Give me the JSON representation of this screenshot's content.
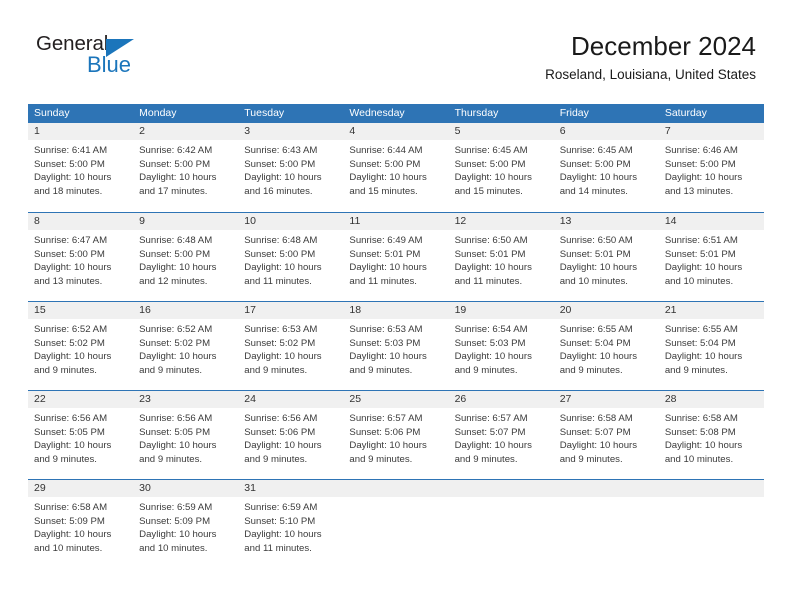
{
  "logo": {
    "word_general": "General",
    "word_blue": "Blue",
    "triangle_color": "#1b75bb"
  },
  "header": {
    "title": "December 2024",
    "subtitle": "Roseland, Louisiana, United States"
  },
  "colors": {
    "header_blue": "#2e74b5",
    "day_band_gray": "#f0f0f0",
    "text": "#3b3b3b"
  },
  "weekdays": [
    "Sunday",
    "Monday",
    "Tuesday",
    "Wednesday",
    "Thursday",
    "Friday",
    "Saturday"
  ],
  "weeks": [
    [
      {
        "day": "1",
        "sunrise": "Sunrise: 6:41 AM",
        "sunset": "Sunset: 5:00 PM",
        "daylight1": "Daylight: 10 hours",
        "daylight2": "and 18 minutes."
      },
      {
        "day": "2",
        "sunrise": "Sunrise: 6:42 AM",
        "sunset": "Sunset: 5:00 PM",
        "daylight1": "Daylight: 10 hours",
        "daylight2": "and 17 minutes."
      },
      {
        "day": "3",
        "sunrise": "Sunrise: 6:43 AM",
        "sunset": "Sunset: 5:00 PM",
        "daylight1": "Daylight: 10 hours",
        "daylight2": "and 16 minutes."
      },
      {
        "day": "4",
        "sunrise": "Sunrise: 6:44 AM",
        "sunset": "Sunset: 5:00 PM",
        "daylight1": "Daylight: 10 hours",
        "daylight2": "and 15 minutes."
      },
      {
        "day": "5",
        "sunrise": "Sunrise: 6:45 AM",
        "sunset": "Sunset: 5:00 PM",
        "daylight1": "Daylight: 10 hours",
        "daylight2": "and 15 minutes."
      },
      {
        "day": "6",
        "sunrise": "Sunrise: 6:45 AM",
        "sunset": "Sunset: 5:00 PM",
        "daylight1": "Daylight: 10 hours",
        "daylight2": "and 14 minutes."
      },
      {
        "day": "7",
        "sunrise": "Sunrise: 6:46 AM",
        "sunset": "Sunset: 5:00 PM",
        "daylight1": "Daylight: 10 hours",
        "daylight2": "and 13 minutes."
      }
    ],
    [
      {
        "day": "8",
        "sunrise": "Sunrise: 6:47 AM",
        "sunset": "Sunset: 5:00 PM",
        "daylight1": "Daylight: 10 hours",
        "daylight2": "and 13 minutes."
      },
      {
        "day": "9",
        "sunrise": "Sunrise: 6:48 AM",
        "sunset": "Sunset: 5:00 PM",
        "daylight1": "Daylight: 10 hours",
        "daylight2": "and 12 minutes."
      },
      {
        "day": "10",
        "sunrise": "Sunrise: 6:48 AM",
        "sunset": "Sunset: 5:00 PM",
        "daylight1": "Daylight: 10 hours",
        "daylight2": "and 11 minutes."
      },
      {
        "day": "11",
        "sunrise": "Sunrise: 6:49 AM",
        "sunset": "Sunset: 5:01 PM",
        "daylight1": "Daylight: 10 hours",
        "daylight2": "and 11 minutes."
      },
      {
        "day": "12",
        "sunrise": "Sunrise: 6:50 AM",
        "sunset": "Sunset: 5:01 PM",
        "daylight1": "Daylight: 10 hours",
        "daylight2": "and 11 minutes."
      },
      {
        "day": "13",
        "sunrise": "Sunrise: 6:50 AM",
        "sunset": "Sunset: 5:01 PM",
        "daylight1": "Daylight: 10 hours",
        "daylight2": "and 10 minutes."
      },
      {
        "day": "14",
        "sunrise": "Sunrise: 6:51 AM",
        "sunset": "Sunset: 5:01 PM",
        "daylight1": "Daylight: 10 hours",
        "daylight2": "and 10 minutes."
      }
    ],
    [
      {
        "day": "15",
        "sunrise": "Sunrise: 6:52 AM",
        "sunset": "Sunset: 5:02 PM",
        "daylight1": "Daylight: 10 hours",
        "daylight2": "and 9 minutes."
      },
      {
        "day": "16",
        "sunrise": "Sunrise: 6:52 AM",
        "sunset": "Sunset: 5:02 PM",
        "daylight1": "Daylight: 10 hours",
        "daylight2": "and 9 minutes."
      },
      {
        "day": "17",
        "sunrise": "Sunrise: 6:53 AM",
        "sunset": "Sunset: 5:02 PM",
        "daylight1": "Daylight: 10 hours",
        "daylight2": "and 9 minutes."
      },
      {
        "day": "18",
        "sunrise": "Sunrise: 6:53 AM",
        "sunset": "Sunset: 5:03 PM",
        "daylight1": "Daylight: 10 hours",
        "daylight2": "and 9 minutes."
      },
      {
        "day": "19",
        "sunrise": "Sunrise: 6:54 AM",
        "sunset": "Sunset: 5:03 PM",
        "daylight1": "Daylight: 10 hours",
        "daylight2": "and 9 minutes."
      },
      {
        "day": "20",
        "sunrise": "Sunrise: 6:55 AM",
        "sunset": "Sunset: 5:04 PM",
        "daylight1": "Daylight: 10 hours",
        "daylight2": "and 9 minutes."
      },
      {
        "day": "21",
        "sunrise": "Sunrise: 6:55 AM",
        "sunset": "Sunset: 5:04 PM",
        "daylight1": "Daylight: 10 hours",
        "daylight2": "and 9 minutes."
      }
    ],
    [
      {
        "day": "22",
        "sunrise": "Sunrise: 6:56 AM",
        "sunset": "Sunset: 5:05 PM",
        "daylight1": "Daylight: 10 hours",
        "daylight2": "and 9 minutes."
      },
      {
        "day": "23",
        "sunrise": "Sunrise: 6:56 AM",
        "sunset": "Sunset: 5:05 PM",
        "daylight1": "Daylight: 10 hours",
        "daylight2": "and 9 minutes."
      },
      {
        "day": "24",
        "sunrise": "Sunrise: 6:56 AM",
        "sunset": "Sunset: 5:06 PM",
        "daylight1": "Daylight: 10 hours",
        "daylight2": "and 9 minutes."
      },
      {
        "day": "25",
        "sunrise": "Sunrise: 6:57 AM",
        "sunset": "Sunset: 5:06 PM",
        "daylight1": "Daylight: 10 hours",
        "daylight2": "and 9 minutes."
      },
      {
        "day": "26",
        "sunrise": "Sunrise: 6:57 AM",
        "sunset": "Sunset: 5:07 PM",
        "daylight1": "Daylight: 10 hours",
        "daylight2": "and 9 minutes."
      },
      {
        "day": "27",
        "sunrise": "Sunrise: 6:58 AM",
        "sunset": "Sunset: 5:07 PM",
        "daylight1": "Daylight: 10 hours",
        "daylight2": "and 9 minutes."
      },
      {
        "day": "28",
        "sunrise": "Sunrise: 6:58 AM",
        "sunset": "Sunset: 5:08 PM",
        "daylight1": "Daylight: 10 hours",
        "daylight2": "and 10 minutes."
      }
    ],
    [
      {
        "day": "29",
        "sunrise": "Sunrise: 6:58 AM",
        "sunset": "Sunset: 5:09 PM",
        "daylight1": "Daylight: 10 hours",
        "daylight2": "and 10 minutes."
      },
      {
        "day": "30",
        "sunrise": "Sunrise: 6:59 AM",
        "sunset": "Sunset: 5:09 PM",
        "daylight1": "Daylight: 10 hours",
        "daylight2": "and 10 minutes."
      },
      {
        "day": "31",
        "sunrise": "Sunrise: 6:59 AM",
        "sunset": "Sunset: 5:10 PM",
        "daylight1": "Daylight: 10 hours",
        "daylight2": "and 11 minutes."
      },
      {
        "day": "",
        "sunrise": "",
        "sunset": "",
        "daylight1": "",
        "daylight2": ""
      },
      {
        "day": "",
        "sunrise": "",
        "sunset": "",
        "daylight1": "",
        "daylight2": ""
      },
      {
        "day": "",
        "sunrise": "",
        "sunset": "",
        "daylight1": "",
        "daylight2": ""
      },
      {
        "day": "",
        "sunrise": "",
        "sunset": "",
        "daylight1": "",
        "daylight2": ""
      }
    ]
  ]
}
